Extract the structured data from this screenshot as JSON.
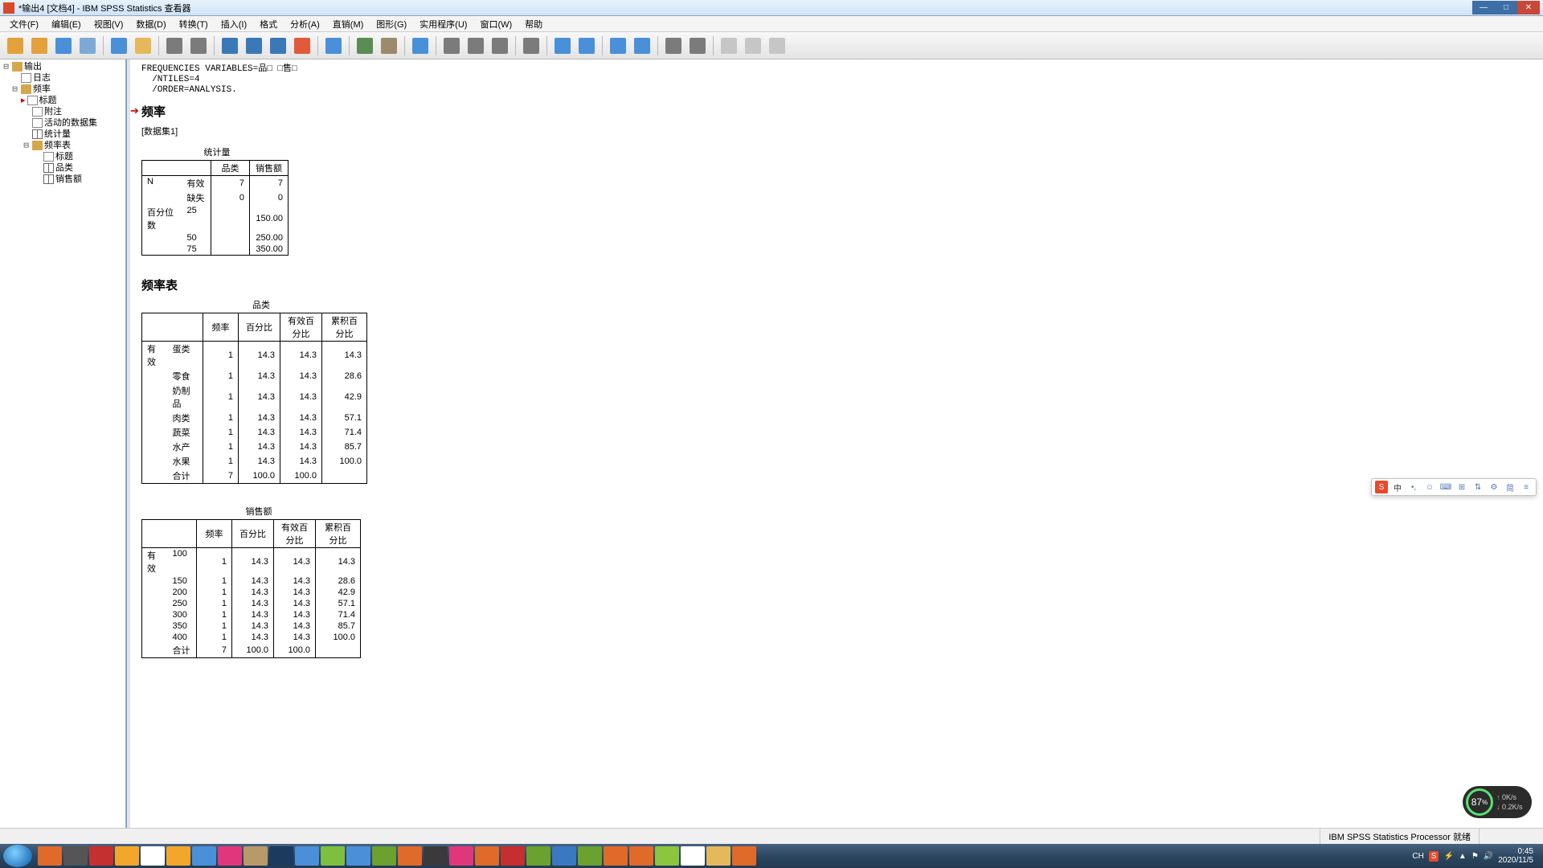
{
  "window": {
    "title": "*输出4 [文档4] - IBM SPSS Statistics 查看器"
  },
  "menu": [
    "文件(F)",
    "编辑(E)",
    "视图(V)",
    "数据(D)",
    "转换(T)",
    "插入(I)",
    "格式",
    "分析(A)",
    "直销(M)",
    "图形(G)",
    "实用程序(U)",
    "窗口(W)",
    "帮助"
  ],
  "nav": {
    "root": "输出",
    "log": "日志",
    "freq": "频率",
    "title": "标题",
    "notes": "附注",
    "active": "活动的数据集",
    "stats": "统计量",
    "freqtab": "频率表",
    "sub_title": "标题",
    "sub_cat": "品类",
    "sub_sales": "销售额"
  },
  "syntax": "FREQUENCIES VARIABLES=品□ □售□\n  /NTILES=4\n  /ORDER=ANALYSIS.",
  "sec_freq": "频率",
  "dataset": "[数据集1]",
  "stats": {
    "title": "统计量",
    "cols": [
      "",
      "",
      "品类",
      "销售额"
    ],
    "rows": [
      [
        "N",
        "有效",
        "7",
        "7"
      ],
      [
        "",
        "缺失",
        "0",
        "0"
      ],
      [
        "百分位数",
        "25",
        "",
        "150.00"
      ],
      [
        "",
        "50",
        "",
        "250.00"
      ],
      [
        "",
        "75",
        "",
        "350.00"
      ]
    ]
  },
  "sec_freqtab": "频率表",
  "cat": {
    "title": "品类",
    "cols": [
      "",
      "",
      "频率",
      "百分比",
      "有效百分比",
      "累积百分比"
    ],
    "rows": [
      [
        "有效",
        "蛋类",
        "1",
        "14.3",
        "14.3",
        "14.3"
      ],
      [
        "",
        "零食",
        "1",
        "14.3",
        "14.3",
        "28.6"
      ],
      [
        "",
        "奶制品",
        "1",
        "14.3",
        "14.3",
        "42.9"
      ],
      [
        "",
        "肉类",
        "1",
        "14.3",
        "14.3",
        "57.1"
      ],
      [
        "",
        "蔬菜",
        "1",
        "14.3",
        "14.3",
        "71.4"
      ],
      [
        "",
        "水产",
        "1",
        "14.3",
        "14.3",
        "85.7"
      ],
      [
        "",
        "水果",
        "1",
        "14.3",
        "14.3",
        "100.0"
      ],
      [
        "",
        "合计",
        "7",
        "100.0",
        "100.0",
        ""
      ]
    ]
  },
  "sales": {
    "title": "销售额",
    "cols": [
      "",
      "",
      "频率",
      "百分比",
      "有效百分比",
      "累积百分比"
    ],
    "rows": [
      [
        "有效",
        "100",
        "1",
        "14.3",
        "14.3",
        "14.3"
      ],
      [
        "",
        "150",
        "1",
        "14.3",
        "14.3",
        "28.6"
      ],
      [
        "",
        "200",
        "1",
        "14.3",
        "14.3",
        "42.9"
      ],
      [
        "",
        "250",
        "1",
        "14.3",
        "14.3",
        "57.1"
      ],
      [
        "",
        "300",
        "1",
        "14.3",
        "14.3",
        "71.4"
      ],
      [
        "",
        "350",
        "1",
        "14.3",
        "14.3",
        "85.7"
      ],
      [
        "",
        "400",
        "1",
        "14.3",
        "14.3",
        "100.0"
      ],
      [
        "",
        "合计",
        "7",
        "100.0",
        "100.0",
        ""
      ]
    ]
  },
  "status": {
    "processor": "IBM SPSS Statistics Processor 就绪"
  },
  "ime": {
    "logo": "S",
    "lang": "中",
    "opts": [
      "•,",
      "☺",
      "⌨",
      "⊞",
      "⇅",
      "⚙",
      "简",
      "≡"
    ]
  },
  "tray": {
    "lang": "CH",
    "s": "S",
    "time": "0:45",
    "date": "2020/11/5"
  },
  "perf": {
    "pct": "87",
    "unit": "%",
    "up": "0K/s",
    "dn": "0.2K/s"
  },
  "toolicons": [
    "#e2a13b",
    "#e2a13b",
    "#4a90d9",
    "#7ea9d6",
    "sep",
    "#4a90d9",
    "#e6b85c",
    "sep",
    "#7b7b7b",
    "#7b7b7b",
    "sep",
    "#3a78b8",
    "#3a78b8",
    "#3a78b8",
    "#e05a3b",
    "sep",
    "#4a90d9",
    "sep",
    "#5b8c55",
    "#9c8a6a",
    "sep",
    "#4a90d9",
    "sep",
    "#7b7b7b",
    "#7b7b7b",
    "#7b7b7b",
    "sep",
    "#7b7b7b",
    "sep",
    "#4a90d9",
    "#4a90d9",
    "sep",
    "#4a90d9",
    "#4a90d9",
    "sep",
    "#7b7b7b",
    "#7b7b7b",
    "sep",
    "#c6c6c6",
    "#c6c6c6",
    "#c6c6c6"
  ],
  "taskicons": [
    "#e06a2a",
    "#555",
    "#c62f2f",
    "#f4a62a",
    "#fff",
    "#f4a62a",
    "#4a90d9",
    "#e0377c",
    "#b89a6a",
    "#1b3a5e",
    "#4a90d9",
    "#7fbf3f",
    "#4a90d9",
    "#6aa12f",
    "#e06a2a",
    "#3a3a3a",
    "#e0377c",
    "#e06a2a",
    "#c62f2f",
    "#6aa12f",
    "#3a78c2",
    "#6aa12f",
    "#e06a2a",
    "#e06a2a",
    "#8cc63f",
    "#fff",
    "#e6b85c",
    "#e06a2a"
  ]
}
